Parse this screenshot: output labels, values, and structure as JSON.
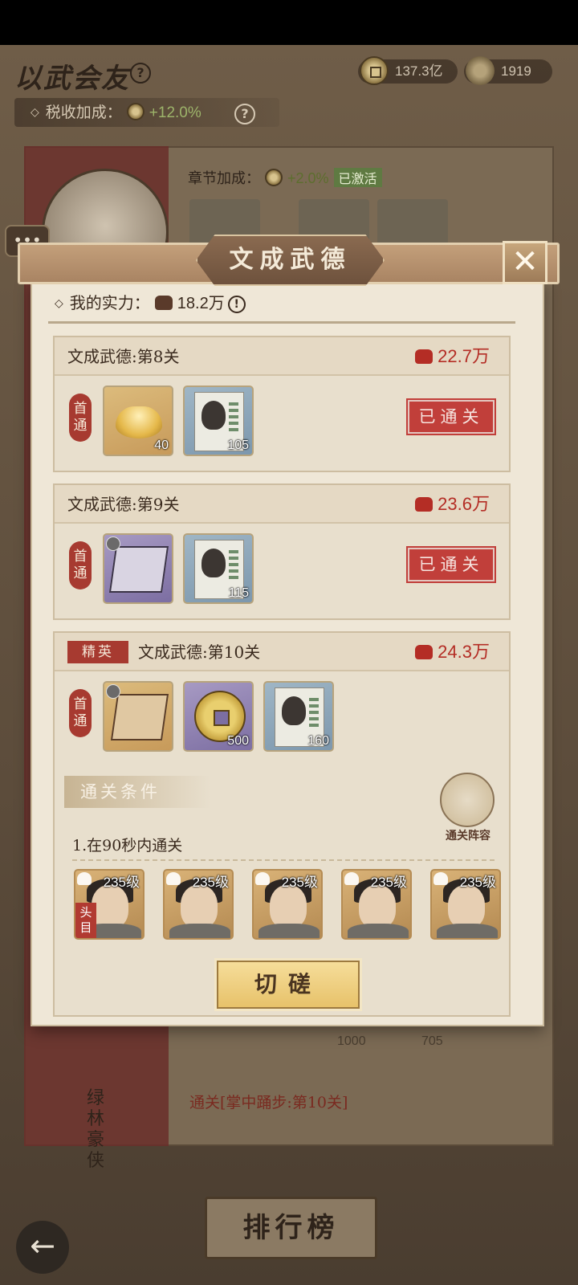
{
  "header": {
    "title": "以武会友",
    "help_symbol": "?",
    "copper_coins": "137.3亿",
    "fame": "1919",
    "tax_bonus_label": "税收加成：",
    "tax_bonus_value": "+12.0%"
  },
  "background": {
    "chapter_bonus_label": "章节加成：",
    "chapter_bonus_value": "+2.0%",
    "chapter_bonus_status": "已激活",
    "side_name": "绿林豪侠",
    "bg_count_1": "1000",
    "bg_count_2": "705",
    "bg_clear_condition": "通关[掌中踊步:第10关]",
    "ranking_button": "排行榜",
    "chat_symbol": "•••",
    "back_symbol": "←"
  },
  "dialog": {
    "title": "文成武德",
    "close_symbol": "✕",
    "my_power_label": "我的实力：",
    "my_power_value": "18.2万",
    "info_symbol": "!",
    "first_clear_label": "首通",
    "passed_label": "已通关",
    "elite_label": "精英",
    "stages": [
      {
        "name": "文成武德:第8关",
        "power": "22.7万",
        "status": "已通关",
        "rewards": [
          {
            "type": "gold-ingot",
            "count": "40"
          },
          {
            "type": "hero-scroll",
            "count": "105"
          }
        ]
      },
      {
        "name": "文成武德:第9关",
        "power": "23.6万",
        "status": "已通关",
        "rewards": [
          {
            "type": "skill-book-box",
            "count": ""
          },
          {
            "type": "hero-scroll",
            "count": "115"
          }
        ]
      },
      {
        "name": "文成武德:第10关",
        "power": "24.3万",
        "elite": true,
        "rewards": [
          {
            "type": "skill-book",
            "count": ""
          },
          {
            "type": "copper-coin",
            "count": "500"
          },
          {
            "type": "hero-scroll",
            "count": "160"
          }
        ]
      }
    ],
    "conditions_title": "通关条件",
    "condition_1": "1.在90秒内通关",
    "lineup_label": "通关阵容",
    "leader_label": "头目",
    "heroes": [
      {
        "level": "235级",
        "leader": true
      },
      {
        "level": "235级"
      },
      {
        "level": "235级"
      },
      {
        "level": "235级"
      },
      {
        "level": "235级"
      }
    ],
    "spar_button": "切磋"
  }
}
